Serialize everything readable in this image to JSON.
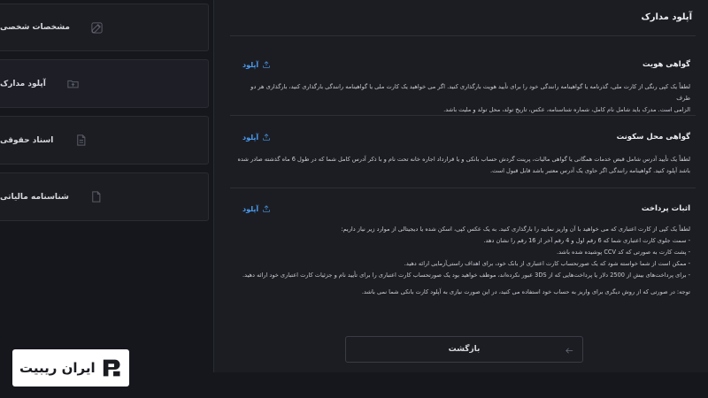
{
  "sidebar": {
    "items": [
      {
        "label": "مشخصات شخصی",
        "icon": "edit-icon"
      },
      {
        "label": "آپلود مدارک",
        "icon": "folder-upload-icon"
      },
      {
        "label": "اسناد حقوقی",
        "icon": "document-icon"
      },
      {
        "label": "شناسنامه مالیاتی",
        "icon": "file-icon"
      }
    ]
  },
  "main": {
    "title": "آپلود مدارک",
    "upload_label": "آپلود",
    "sections": [
      {
        "title": "گواهی هویت",
        "lines": [
          "لطفاً یک کپی رنگی از کارت ملی، گذرنامه یا گواهینامه رانندگی خود را برای تأیید هویت بارگذاری کنید. اگر می خواهید یک کارت ملی یا گواهینامه رانندگی بارگذاری کنید، بارگذاری هر دو طرف",
          "الزامی است. مدرک باید شامل نام کامل، شماره شناسنامه، عکس، تاریخ تولد، محل تولد و ملیت باشد."
        ]
      },
      {
        "title": "گواهی محل سکونت",
        "lines": [
          "لطفاً یک تأیید آدرس شامل قبض خدمات همگانی یا گواهی مالیات، پرینت گردش حساب بانکی و یا قرارداد اجاره خانه تحت نام و با ذکر آدرس کامل شما که در طول 6 ماه گذشته صادر شده",
          "باشد آپلود کنید. گواهینامه رانندگی اگر حاوی یک آدرس معتبر باشد قابل قبول است."
        ]
      },
      {
        "title": "اثبات پرداخت",
        "lines": [
          "لطفاً یک کپی از کارت اعتباری که می خواهید با آن واریز نمایید را بارگذاری کنید. به یک عکس کپی، اسکن شده یا دیجیتالی از موارد زیر نیاز داریم:",
          "- سمت جلوی کارت اعتباری شما که 6 رقم اول و 4 رقم آخر از 16 رقم را نشان دهد.",
          "- پشت کارت به صورتی که کد CCV پوشیده شده باشد.",
          "- ممکن است از شما خواسته شود که یک صورتحساب کارت اعتباری از بانک خود، برای اهداف راستی‌آزمایی ارائه دهید.",
          "- برای پرداخت‌های بیش از 2500 دلار یا پرداخت‌هایی که از 3DS عبور نکرده‌اند، موظف خواهید بود یک صورتحساب کارت اعتباری را برای تأیید نام و جزئیات کارت اعتباری خود ارائه دهید.",
          "",
          "توجه: در صورتی که از روش دیگری برای واریز به حساب خود استفاده می کنید، در این صورت نیازی به آپلود کارت بانکی شما نمی باشد."
        ]
      }
    ],
    "back_label": "بازگشت"
  },
  "logo": {
    "text": "ایران ریبیت"
  }
}
